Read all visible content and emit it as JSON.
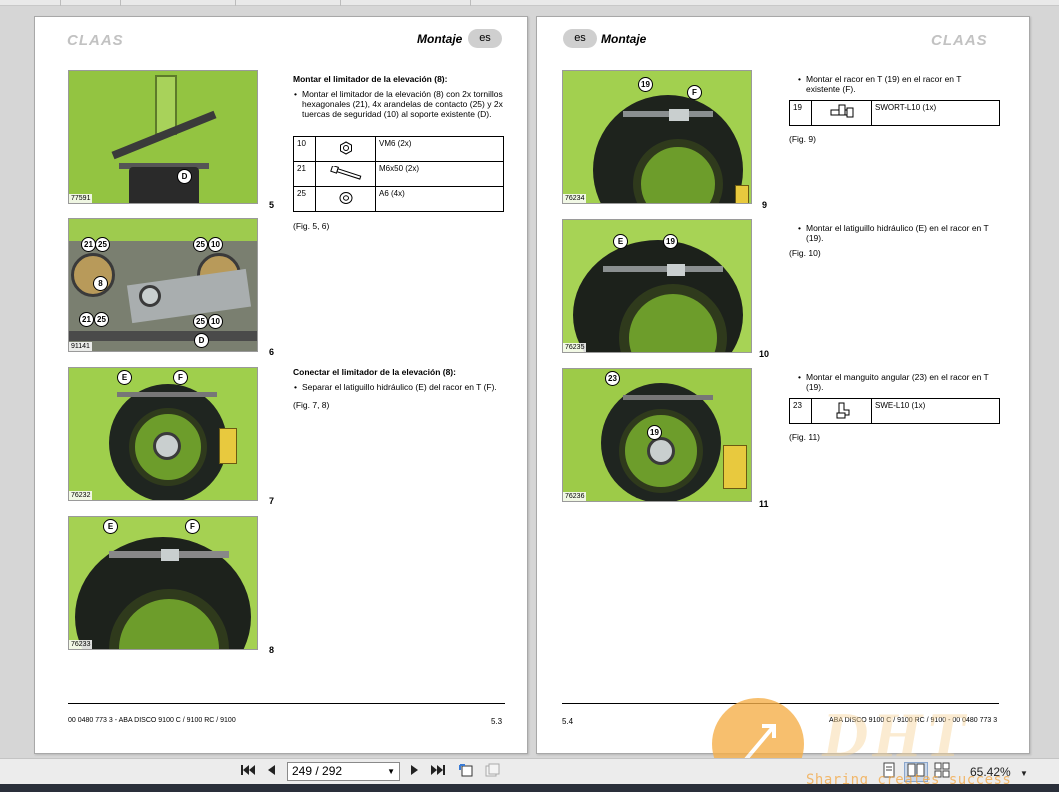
{
  "left_page": {
    "logo": "CLAAS",
    "header_title": "Montaje",
    "lang": "es",
    "section1": {
      "heading": "Montar el limitador de la elevación (8):",
      "bullet": "Montar el limitador de la elevación (8) con 2x tornillos hexagonales (21), 4x arandelas de contacto (25) y 2x tuercas de seguridad (10) al soporte existente (D).",
      "parts": [
        {
          "num": "10",
          "icon": "nut-icon",
          "desc": "VM6 (2x)"
        },
        {
          "num": "21",
          "icon": "bolt-icon",
          "desc": "M6x50 (2x)"
        },
        {
          "num": "25",
          "icon": "washer-icon",
          "desc": "A6 (4x)"
        }
      ],
      "ref": "(Fig. 5, 6)"
    },
    "section2": {
      "heading": "Conectar el limitador de la elevación (8):",
      "bullet": "Separar el latiguillo hidráulico (E) del racor en T (F).",
      "ref": "(Fig. 7, 8)"
    },
    "figures": [
      {
        "number": "5",
        "image_no": "77591",
        "callouts": [
          "D"
        ]
      },
      {
        "number": "6",
        "image_no": "91141",
        "callouts": [
          "21",
          "25",
          "25",
          "10",
          "8",
          "21",
          "25",
          "25",
          "10",
          "D"
        ]
      },
      {
        "number": "7",
        "image_no": "76232",
        "callouts": [
          "E",
          "F"
        ]
      },
      {
        "number": "8",
        "image_no": "76233",
        "callouts": [
          "E",
          "F"
        ]
      }
    ],
    "footer_left": "00 0480 773 3 - ABA DISCO 9100 C / 9100 RC / 9100",
    "footer_right": "5.3"
  },
  "right_page": {
    "logo": "CLAAS",
    "header_title": "Montaje",
    "lang": "es",
    "steps": [
      {
        "bullet": "Montar el racor en T (19) en el racor en T existente (F).",
        "part": {
          "num": "19",
          "icon": "tee-fitting-icon",
          "desc": "SWORT-L10 (1x)"
        },
        "ref": "(Fig. 9)"
      },
      {
        "bullet": "Montar el latiguillo hidráulico (E) en el racor en T (19).",
        "ref": "(Fig. 10)"
      },
      {
        "bullet": "Montar el manguito angular (23) en el racor en T (19).",
        "part": {
          "num": "23",
          "icon": "elbow-fitting-icon",
          "desc": "SWE-L10 (1x)"
        },
        "ref": "(Fig. 11)"
      }
    ],
    "figures": [
      {
        "number": "9",
        "image_no": "76234",
        "callouts": [
          "19",
          "F"
        ]
      },
      {
        "number": "10",
        "image_no": "76235",
        "callouts": [
          "E",
          "19"
        ]
      },
      {
        "number": "11",
        "image_no": "76236",
        "callouts": [
          "23",
          "19"
        ]
      }
    ],
    "footer_left": "5.4",
    "footer_right": "ABA DISCO 9100 C / 9100 RC / 9100 - 00 0480 773 3"
  },
  "toolbar": {
    "page_field": "249 / 292",
    "zoom": "65.42%",
    "first_icon": "first-page-icon",
    "prev_icon": "prev-page-icon",
    "next_icon": "next-page-icon",
    "last_icon": "last-page-icon"
  },
  "watermark": {
    "text": "Sharing creates success",
    "big": "DHT"
  }
}
